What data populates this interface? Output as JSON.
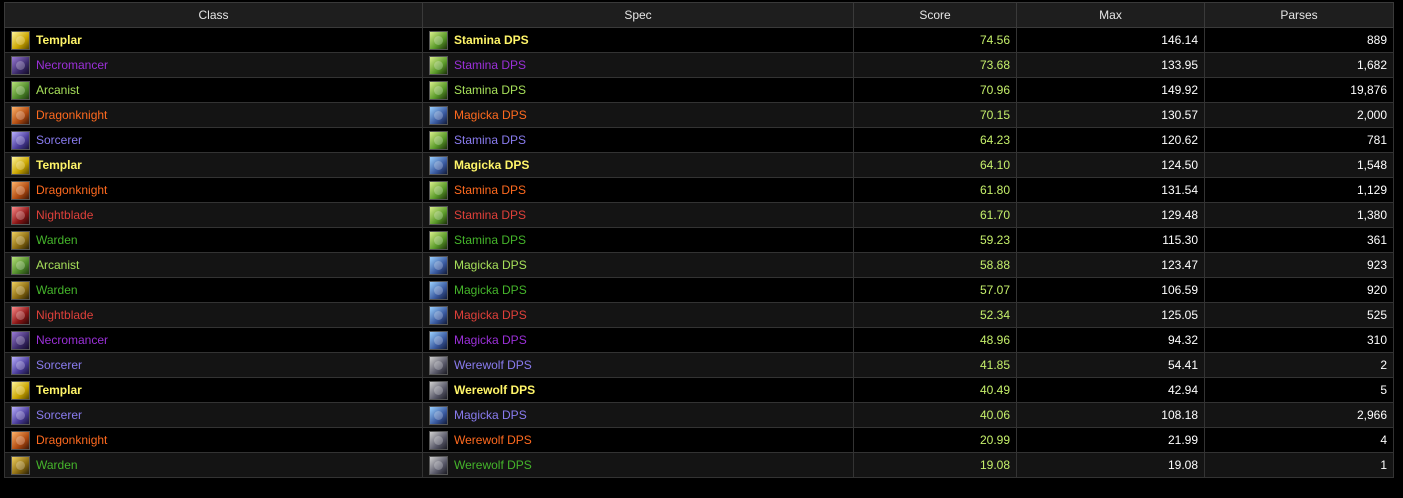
{
  "headers": {
    "class": "Class",
    "spec": "Spec",
    "score": "Score",
    "max": "Max",
    "parses": "Parses"
  },
  "class_colors": {
    "Templar": "#fff569",
    "Necromancer": "#9b30d9",
    "Arcanist": "#a7e05a",
    "Dragonknight": "#ff6a1f",
    "Sorcerer": "#8a7cf0",
    "Nightblade": "#e0403a",
    "Warden": "#45b52b"
  },
  "rows": [
    {
      "class": "Templar",
      "class_icon": "templar-icon",
      "spec": "Stamina DPS",
      "spec_icon": "stamina-skill-icon",
      "score": "74.56",
      "max": "146.14",
      "parses": "889",
      "bold": true
    },
    {
      "class": "Necromancer",
      "class_icon": "necromancer-icon",
      "spec": "Stamina DPS",
      "spec_icon": "stamina-skill-icon",
      "score": "73.68",
      "max": "133.95",
      "parses": "1,682",
      "bold": false
    },
    {
      "class": "Arcanist",
      "class_icon": "arcanist-icon",
      "spec": "Stamina DPS",
      "spec_icon": "stamina-skill-icon",
      "score": "70.96",
      "max": "149.92",
      "parses": "19,876",
      "bold": false
    },
    {
      "class": "Dragonknight",
      "class_icon": "dragonknight-icon",
      "spec": "Magicka DPS",
      "spec_icon": "magicka-skill-icon",
      "score": "70.15",
      "max": "130.57",
      "parses": "2,000",
      "bold": false
    },
    {
      "class": "Sorcerer",
      "class_icon": "sorcerer-icon",
      "spec": "Stamina DPS",
      "spec_icon": "stamina-skill-icon",
      "score": "64.23",
      "max": "120.62",
      "parses": "781",
      "bold": false
    },
    {
      "class": "Templar",
      "class_icon": "templar-icon",
      "spec": "Magicka DPS",
      "spec_icon": "magicka-skill-icon",
      "score": "64.10",
      "max": "124.50",
      "parses": "1,548",
      "bold": true
    },
    {
      "class": "Dragonknight",
      "class_icon": "dragonknight-icon",
      "spec": "Stamina DPS",
      "spec_icon": "stamina-skill-icon",
      "score": "61.80",
      "max": "131.54",
      "parses": "1,129",
      "bold": false
    },
    {
      "class": "Nightblade",
      "class_icon": "nightblade-icon",
      "spec": "Stamina DPS",
      "spec_icon": "stamina-skill-icon",
      "score": "61.70",
      "max": "129.48",
      "parses": "1,380",
      "bold": false
    },
    {
      "class": "Warden",
      "class_icon": "warden-icon",
      "spec": "Stamina DPS",
      "spec_icon": "stamina-skill-icon",
      "score": "59.23",
      "max": "115.30",
      "parses": "361",
      "bold": false
    },
    {
      "class": "Arcanist",
      "class_icon": "arcanist-icon",
      "spec": "Magicka DPS",
      "spec_icon": "magicka-skill-icon",
      "score": "58.88",
      "max": "123.47",
      "parses": "923",
      "bold": false
    },
    {
      "class": "Warden",
      "class_icon": "warden-icon",
      "spec": "Magicka DPS",
      "spec_icon": "magicka-skill-icon",
      "score": "57.07",
      "max": "106.59",
      "parses": "920",
      "bold": false
    },
    {
      "class": "Nightblade",
      "class_icon": "nightblade-icon",
      "spec": "Magicka DPS",
      "spec_icon": "magicka-skill-icon",
      "score": "52.34",
      "max": "125.05",
      "parses": "525",
      "bold": false
    },
    {
      "class": "Necromancer",
      "class_icon": "necromancer-icon",
      "spec": "Magicka DPS",
      "spec_icon": "magicka-skill-icon",
      "score": "48.96",
      "max": "94.32",
      "parses": "310",
      "bold": false
    },
    {
      "class": "Sorcerer",
      "class_icon": "sorcerer-icon",
      "spec": "Werewolf DPS",
      "spec_icon": "werewolf-skill-icon",
      "score": "41.85",
      "max": "54.41",
      "parses": "2",
      "bold": false
    },
    {
      "class": "Templar",
      "class_icon": "templar-icon",
      "spec": "Werewolf DPS",
      "spec_icon": "werewolf-skill-icon",
      "score": "40.49",
      "max": "42.94",
      "parses": "5",
      "bold": true
    },
    {
      "class": "Sorcerer",
      "class_icon": "sorcerer-icon",
      "spec": "Magicka DPS",
      "spec_icon": "magicka-skill-icon",
      "score": "40.06",
      "max": "108.18",
      "parses": "2,966",
      "bold": false
    },
    {
      "class": "Dragonknight",
      "class_icon": "dragonknight-icon",
      "spec": "Werewolf DPS",
      "spec_icon": "werewolf-skill-icon",
      "score": "20.99",
      "max": "21.99",
      "parses": "4",
      "bold": false
    },
    {
      "class": "Warden",
      "class_icon": "warden-icon",
      "spec": "Werewolf DPS",
      "spec_icon": "werewolf-skill-icon",
      "score": "19.08",
      "max": "19.08",
      "parses": "1",
      "bold": false
    }
  ]
}
